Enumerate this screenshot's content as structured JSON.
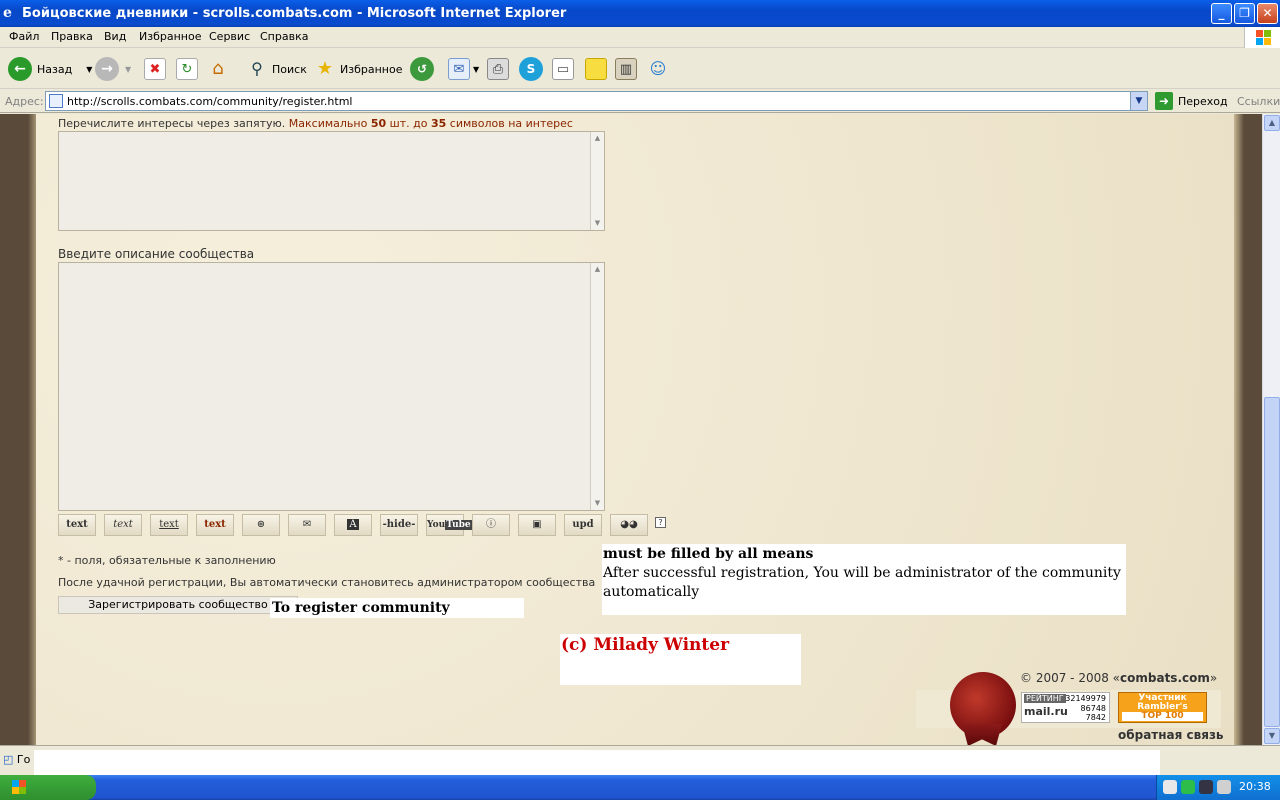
{
  "window": {
    "title": "Бойцовские дневники - scrolls.combats.com - Microsoft Internet Explorer"
  },
  "menu": [
    "Файл",
    "Правка",
    "Вид",
    "Избранное",
    "Сервис",
    "Справка"
  ],
  "toolbar": {
    "back_label": "Назад",
    "search_label": "Поиск",
    "favorites_label": "Избранное"
  },
  "address": {
    "label": "Адрес:",
    "url": "http://scrolls.combats.com/community/register.html",
    "go_label": "Переход",
    "links_label": "Ссылки"
  },
  "form": {
    "interests_label": "Перечислите интересы через запятую.",
    "interests_hint_a": "Максимально",
    "interests_max": "50",
    "interests_hint_b": "шт. до",
    "interests_len": "35",
    "interests_hint_c": "символов на интерес",
    "description_label": "Введите описание сообщества",
    "required_note": "* - поля, обязательные к заполнению",
    "admin_note": "После удачной регистрации, Вы автоматически становитесь администратором сообщества",
    "submit_label": "Зарегистрировать сообщество"
  },
  "bbcode_buttons": [
    "text",
    "text",
    "text",
    "text",
    "link",
    "mail",
    "A",
    "-hide-",
    "YouTube",
    "info",
    "img",
    "upd",
    "eyes"
  ],
  "overlays": {
    "submit_translation": "To register community",
    "required_translation_1": "must be filled by all means",
    "required_translation_2": "After successful registration, You will be administrator of the community automatically",
    "credit": "(c) Milady Winter"
  },
  "footer": {
    "copyright_prefix": "© 2007 - 2008 «",
    "copyright_site": "combats.com",
    "copyright_suffix": "»",
    "mailru_rating": "РЕЙТИНГ",
    "mailru_value1": "32149979",
    "mailru_value2": "86748",
    "mailru_value3": "7842",
    "mailru_logo": "mail.ru",
    "rambler_line1": "Участник",
    "rambler_line2": "Rambler's",
    "rambler_line3": "TOP 100",
    "feedback": "обратная связь"
  },
  "status": {
    "text": "Го"
  },
  "taskbar": {
    "time": "20:38"
  },
  "colors": {
    "titlebar": "#0747c8",
    "parchment": "#f1ead6",
    "accent_red": "#8b2500",
    "credit_red": "#cc0000"
  }
}
